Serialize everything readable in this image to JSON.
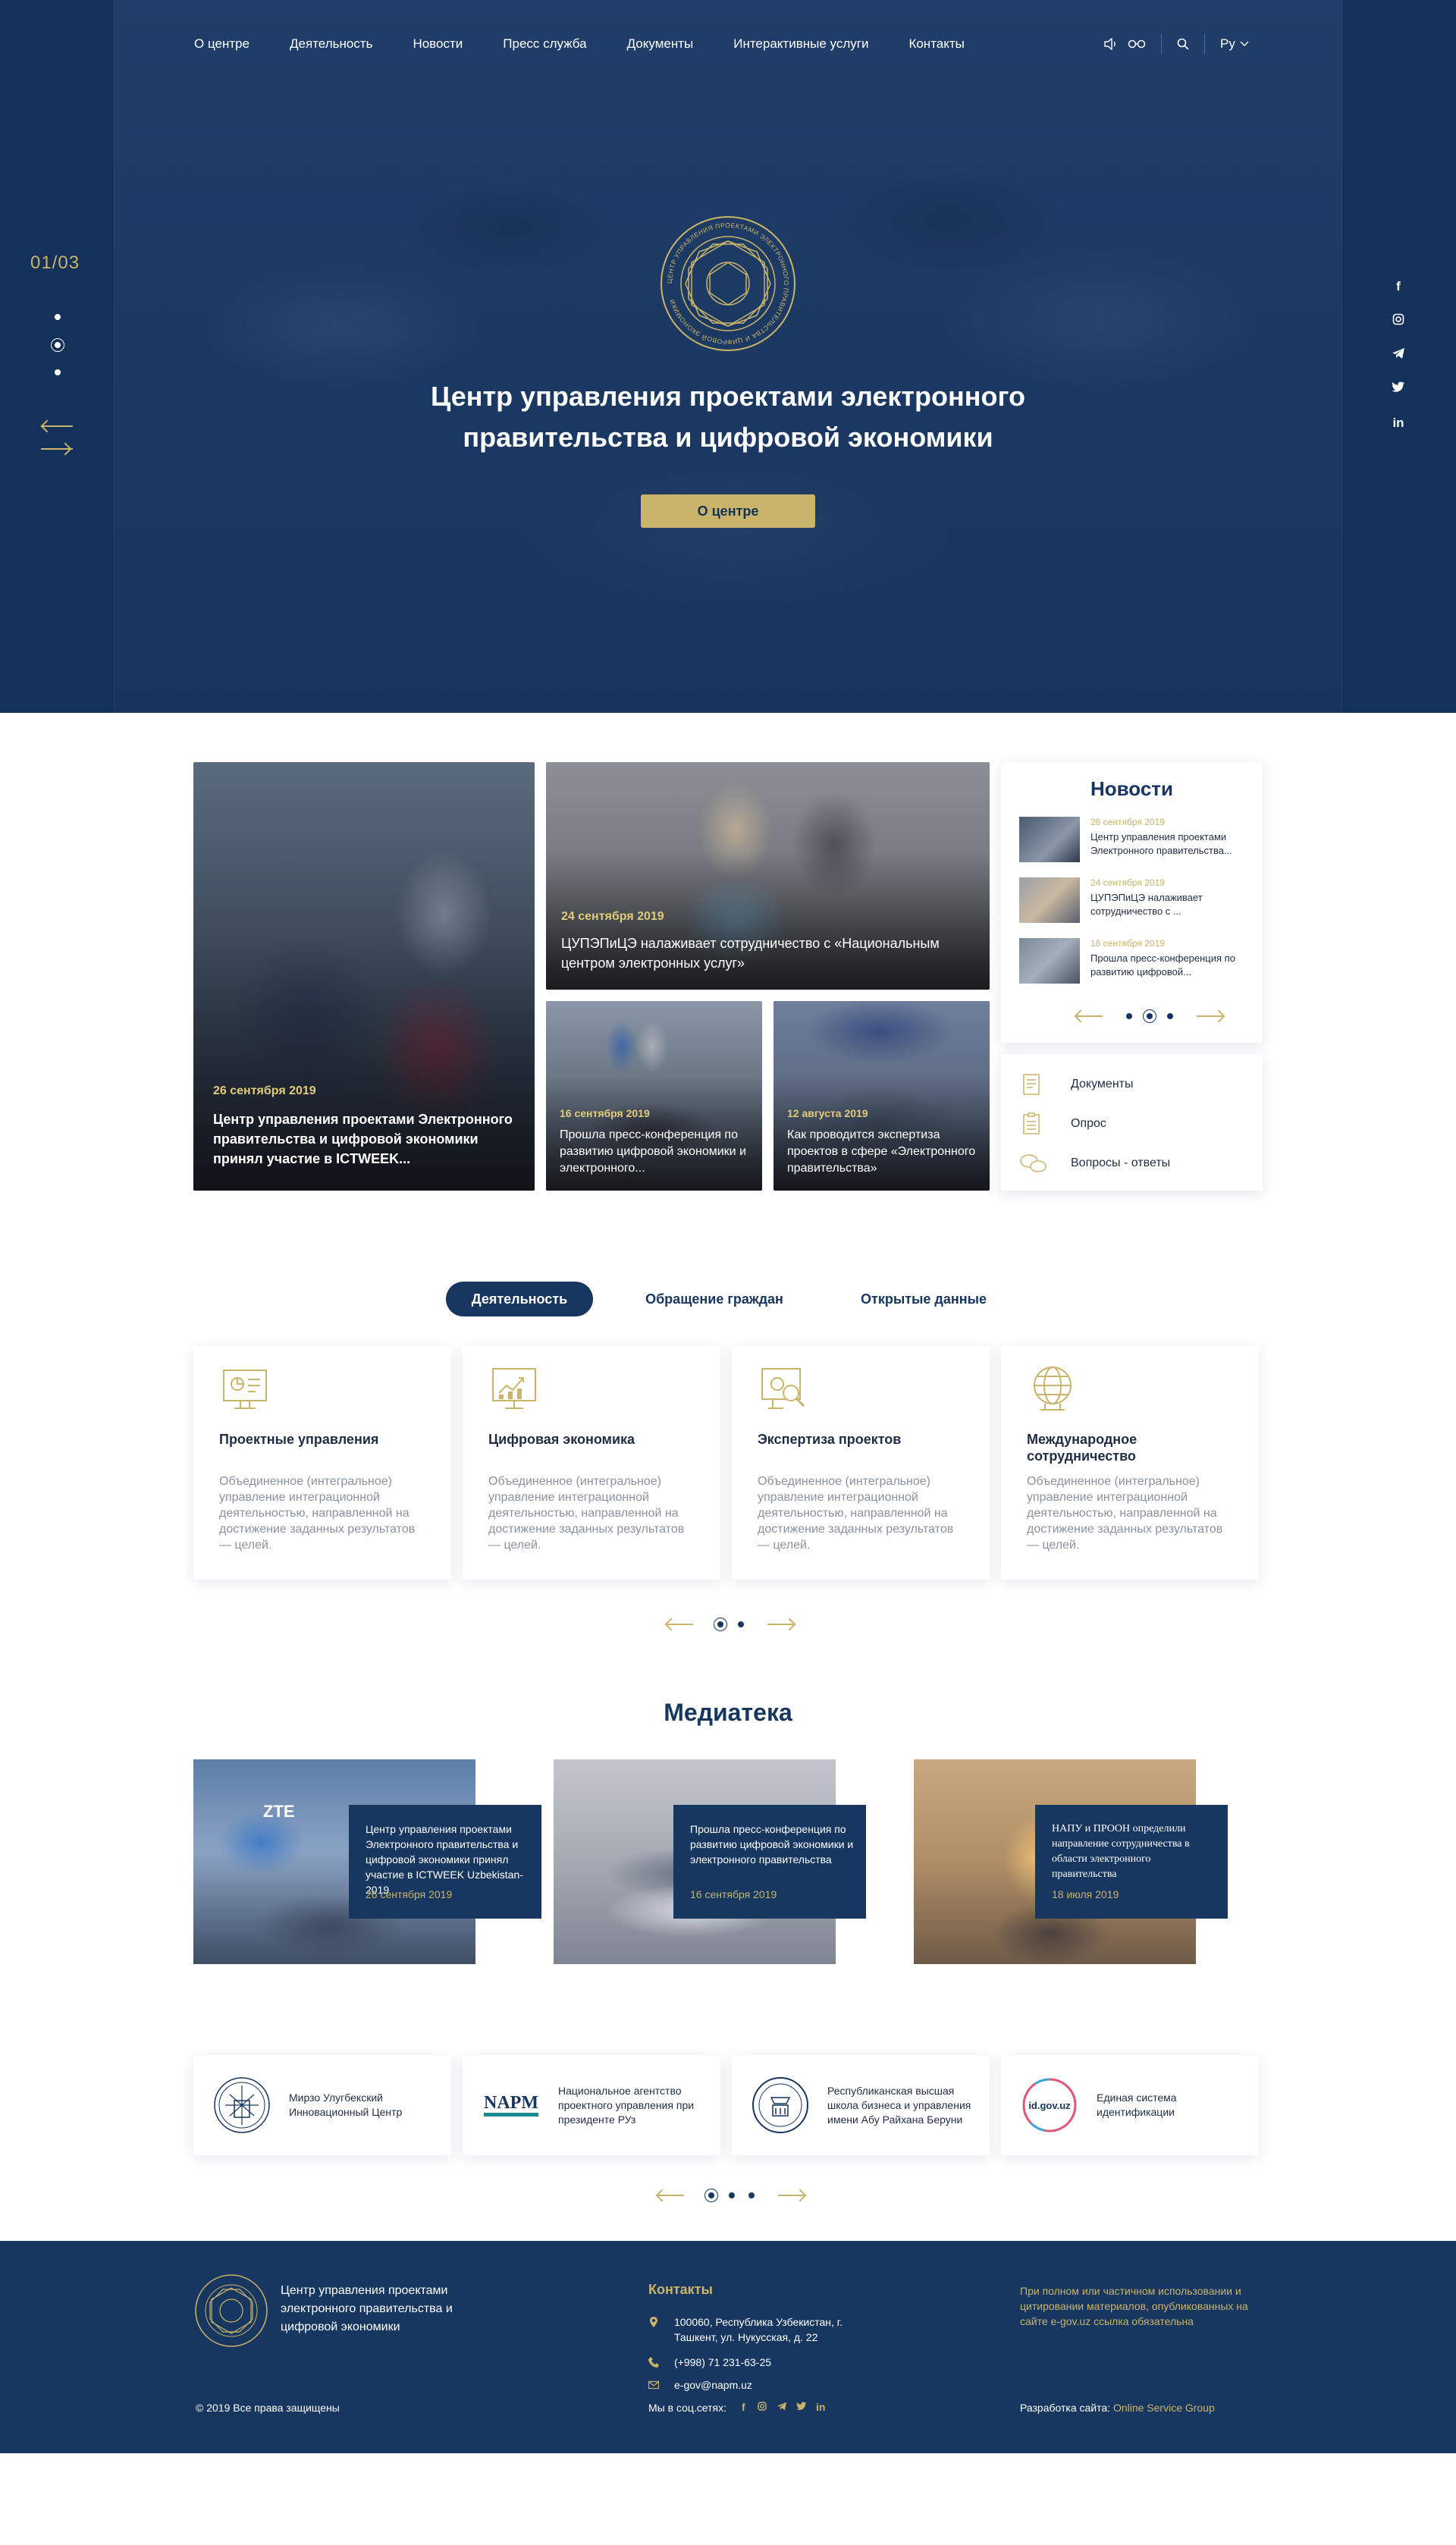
{
  "nav": {
    "items": [
      "О центре",
      "Деятельность",
      "Новости",
      "Пресс служба",
      "Документы",
      "Интерактивные услуги",
      "Контакты"
    ],
    "language": "Ру"
  },
  "hero": {
    "counter": "01/03",
    "title": "Центр управления проектами электронного правительства и цифровой экономики",
    "button": "О центре",
    "emblem_text": "ЦЕНТР УПРАВЛЕНИЯ ПРОЕКТАМИ ЭЛЕКТРОННОГО ПРАВИТЕЛЬСТВА И ЦИФРОВОЙ ЭКОНОМИКИ"
  },
  "news": {
    "big": {
      "date": "26 сентября 2019",
      "title": "Центр управления проектами Электронного правительства и цифровой экономики принял участие в ICTWEEK..."
    },
    "top": {
      "date": "24 сентября 2019",
      "title": "ЦУПЭПиЦЭ налаживает сотрудничество с «Национальным центром электронных услуг»"
    },
    "small1": {
      "date": "16 сентября 2019",
      "title": "Прошла пресс-конференция по развитию цифровой экономики и электронного..."
    },
    "small2": {
      "date": "12 августа 2019",
      "title": "Как проводится экспертиза проектов в сфере «Электронного правительства»"
    }
  },
  "news_panel": {
    "title": "Новости",
    "items": [
      {
        "date": "26 сентября 2019",
        "text": "Центр управления проектами Электронного правительства..."
      },
      {
        "date": "24 сентября 2019",
        "text": "ЦУПЭПиЦЭ налаживает сотрудничество с ..."
      },
      {
        "date": "16 сентября 2019",
        "text": "Прошла пресс-конференция по развитию цифровой..."
      }
    ]
  },
  "links": [
    "Документы",
    "Опрос",
    "Вопросы - ответы"
  ],
  "tabs": [
    "Деятельность",
    "Обращение граждан",
    "Открытые данные"
  ],
  "activities": [
    {
      "title": "Проектные управления",
      "text": "Объединенное (интегральное) управление интеграционной деятельностью, направленной на достижение заданных результатов — целей."
    },
    {
      "title": "Цифровая экономика",
      "text": "Объединенное (интегральное) управление интеграционной деятельностью, направленной на достижение заданных результатов — целей."
    },
    {
      "title": "Экспертиза проектов",
      "text": "Объединенное (интегральное) управление интеграционной деятельностью, направленной на достижение заданных результатов — целей."
    },
    {
      "title": "Международное сотрудничество",
      "text": "Объединенное (интегральное) управление интеграционной деятельностью, направленной на достижение заданных результатов — целей."
    }
  ],
  "media": {
    "title": "Медиатека",
    "items": [
      {
        "title": "Центр управления проектами Электронного правительства и цифровой экономики принял участие в ICTWEEK Uzbekistan-2019",
        "date": "26 сентября 2019",
        "sign": "ZTE"
      },
      {
        "title": "Прошла пресс-конференция по развитию цифровой экономики и электронного правительства",
        "date": "16 сентября 2019"
      },
      {
        "title": "НАПУ и ПРООН определили направление сотрудничества в области электронного правительства",
        "date": "18 июля 2019"
      }
    ]
  },
  "partners": [
    {
      "name": "Мирзо Улугбекский Инновационный Центр"
    },
    {
      "name": "Национальное агентство проектного управления при президенте РУз",
      "logo_text": "NAPM"
    },
    {
      "name": "Республиканская высшая школа бизнеса и управления имени Абу Райхана Беруни"
    },
    {
      "name": "Единая система идентификации",
      "logo_text": "id.gov.uz"
    }
  ],
  "footer": {
    "title": "Центр управления проектами электронного правительства и цифровой экономики",
    "copyright": "© 2019 Все права защищены",
    "contacts_title": "Контакты",
    "address": "100060, Республика Узбекистан, г. Ташкент, ул. Нукусская, д. 22",
    "phone": "(+998) 71 231-63-25",
    "email": "e-gov@napm.uz",
    "social_label": "Мы в соц.сетях:",
    "note": "При полном или частичном использовании и цитировании материалов, опубликованных на сайте e-gov.uz ссылка обязательна",
    "dev_label": "Разработка сайта:",
    "dev_link": "Online Service Group"
  },
  "colors": {
    "navy": "#173660",
    "gold": "#c9b46a"
  },
  "icons": [
    "speaker-icon",
    "glasses-icon",
    "search-icon",
    "chevron-down-icon",
    "facebook-icon",
    "instagram-icon",
    "telegram-icon",
    "twitter-icon",
    "linkedin-icon"
  ]
}
